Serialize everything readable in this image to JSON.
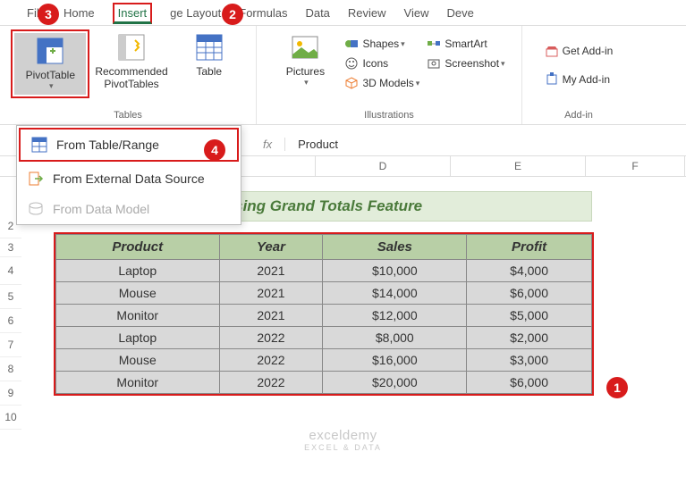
{
  "tabs": {
    "file": "File",
    "home": "Home",
    "insert": "Insert",
    "page": "ge Layout",
    "formulas": "Formulas",
    "data": "Data",
    "review": "Review",
    "view": "View",
    "dev": "Deve"
  },
  "ribbon": {
    "pivot": "PivotTable",
    "recpivot": "Recommended\nPivotTables",
    "table": "Table",
    "pictures": "Pictures",
    "shapes": "Shapes",
    "icons": "Icons",
    "models": "3D Models",
    "smartart": "SmartArt",
    "screenshot": "Screenshot",
    "getaddin": "Get Add-in",
    "myaddin": "My Add-in",
    "grp_tables": "Tables",
    "grp_illus": "Illustrations",
    "grp_addins": "Add-in"
  },
  "dropdown": {
    "r1": "From Table/Range",
    "r2": "From External Data Source",
    "r3": "From Data Model"
  },
  "formula": {
    "fx": "fx",
    "val": "Product"
  },
  "cols": {
    "d": "D",
    "e": "E",
    "f": "F"
  },
  "rows": {
    "r2": "2",
    "r3": "3",
    "r4": "4",
    "r5": "5",
    "r6": "6",
    "r7": "7",
    "r8": "8",
    "r9": "9",
    "r10": "10"
  },
  "title": "Using Grand Totals Feature",
  "headers": {
    "c1": "Product",
    "c2": "Year",
    "c3": "Sales",
    "c4": "Profit"
  },
  "data": [
    {
      "p": "Laptop",
      "y": "2021",
      "s": "$10,000",
      "pr": "$4,000"
    },
    {
      "p": "Mouse",
      "y": "2021",
      "s": "$14,000",
      "pr": "$6,000"
    },
    {
      "p": "Monitor",
      "y": "2021",
      "s": "$12,000",
      "pr": "$5,000"
    },
    {
      "p": "Laptop",
      "y": "2022",
      "s": "$8,000",
      "pr": "$2,000"
    },
    {
      "p": "Mouse",
      "y": "2022",
      "s": "$16,000",
      "pr": "$3,000"
    },
    {
      "p": "Monitor",
      "y": "2022",
      "s": "$20,000",
      "pr": "$6,000"
    }
  ],
  "callouts": {
    "c1": "1",
    "c2": "2",
    "c3": "3",
    "c4": "4"
  },
  "watermark": {
    "l1": "exceldemy",
    "l2": "EXCEL & DATA"
  }
}
